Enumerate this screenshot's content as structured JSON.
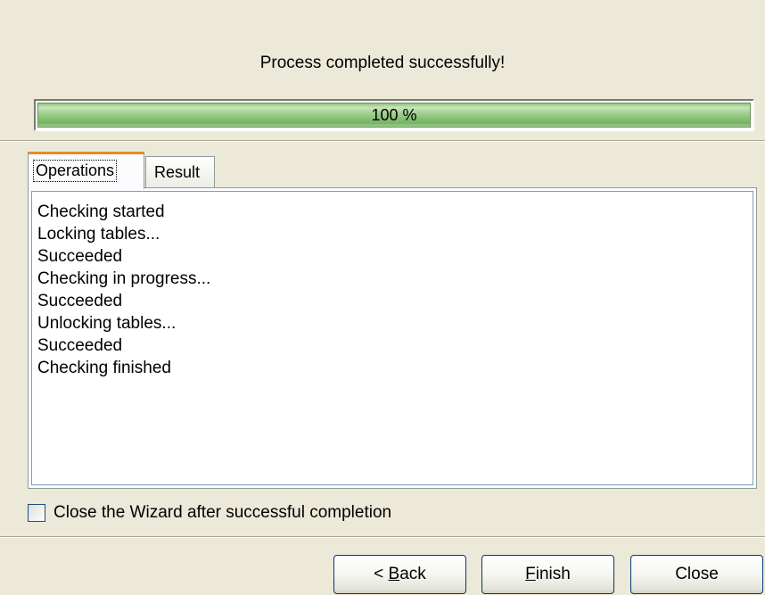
{
  "status": {
    "message": "Process completed successfully!"
  },
  "progress": {
    "percent": 100,
    "label": "100 %",
    "color": "#86c274"
  },
  "tabs": [
    {
      "label": "Operations",
      "active": true
    },
    {
      "label": "Result",
      "active": false
    }
  ],
  "log": {
    "lines": [
      "Checking started",
      "Locking tables...",
      "Succeeded",
      "Checking in progress...",
      "Succeeded",
      "Unlocking tables...",
      "Succeeded",
      "Checking finished"
    ]
  },
  "options": {
    "close_wizard_label": "Close the Wizard after successful completion",
    "close_wizard_checked": false
  },
  "buttons": {
    "back": {
      "prefix": "< ",
      "mnemonic": "B",
      "rest": "ack"
    },
    "finish": {
      "mnemonic": "F",
      "rest": "inish"
    },
    "close": {
      "label": "Close"
    }
  }
}
